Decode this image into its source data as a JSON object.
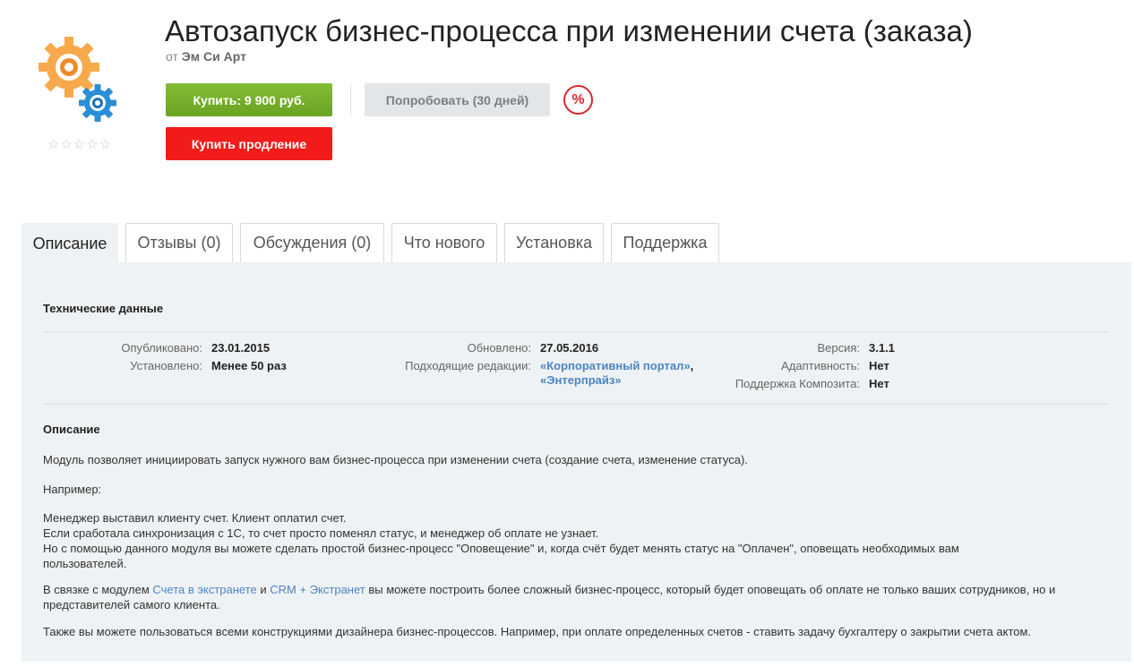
{
  "header": {
    "title": "Автозапуск бизнес-процесса при изменении счета (заказа)",
    "by_prefix": "от",
    "vendor": "Эм Си Арт",
    "rating_stars": [
      "☆",
      "☆",
      "☆",
      "☆",
      "☆"
    ]
  },
  "buttons": {
    "buy": "Купить: 9 900 руб.",
    "try": "Попробовать (30 дней)",
    "renew": "Купить продление",
    "discount": "%"
  },
  "tabs": [
    "Описание",
    "Отзывы (0)",
    "Обсуждения (0)",
    "Что нового",
    "Установка",
    "Поддержка"
  ],
  "tech": {
    "heading": "Технические данные",
    "published_label": "Опубликовано:",
    "published_value": "23.01.2015",
    "installed_label": "Установлено:",
    "installed_value": "Менее 50 раз",
    "updated_label": "Обновлено:",
    "updated_value": "27.05.2016",
    "editions_label": "Подходящие редакции:",
    "editions_line1": "«Корпоративный портал»",
    "editions_comma": ",",
    "editions_line2": "«Энтерпрайз»",
    "version_label": "Версия:",
    "version_value": "3.1.1",
    "adaptive_label": "Адаптивность:",
    "adaptive_value": "Нет",
    "composite_label": "Поддержка Композита:",
    "composite_value": "Нет"
  },
  "description": {
    "heading": "Описание",
    "p1": "Модуль позволяет инициировать запуск нужного вам бизнес-процесса при изменении счета (создание счета, изменение статуса).",
    "p2": "Например:",
    "p3_l1": "Менеджер выставил клиенту счет. Клиент оплатил счет.",
    "p3_l2": "Если сработала синхронизация с 1С, то счет просто поменял статус, и менеджер об оплате не узнает.",
    "p3_l3": "Но с помощью данного модуля вы можете сделать простой бизнес-процесс \"Оповещение\" и, когда счёт будет менять статус на \"Оплачен\", оповещать необходимых вам пользователей.",
    "p4_a": "В связке с модулем ",
    "p4_link1": "Счета в экстранете",
    "p4_b": " и ",
    "p4_link2": "CRM + Экстранет",
    "p4_c": " вы можете построить более сложный бизнес-процесс, который будет оповещать об оплате не только ваших сотрудников, но и представителей самого клиента.",
    "p5": "Также вы можете пользоваться всеми конструкциями дизайнера бизнес-процессов. Например, при оплате определенных счетов - ставить задачу бухгалтеру о закрытии счета актом."
  },
  "colors": {
    "buy_green": "#75b02b",
    "renew_red": "#f21b1b",
    "link_blue": "#4d85c2",
    "panel_bg": "#eff2f4"
  }
}
